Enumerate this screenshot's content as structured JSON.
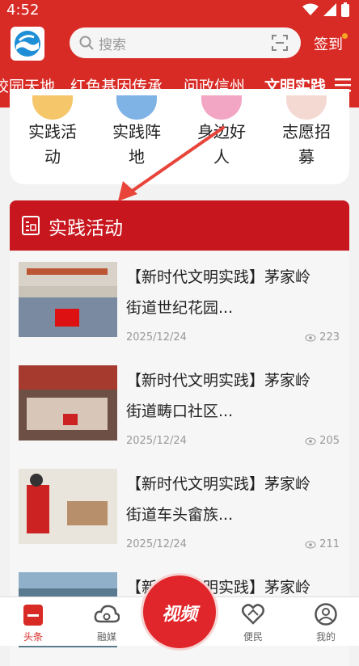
{
  "status": {
    "time": "4:52"
  },
  "header": {
    "search_placeholder": "搜索",
    "signin_label": "签到",
    "tabs": [
      {
        "label": "校园天地"
      },
      {
        "label": "红色基因传承"
      },
      {
        "label": "问政信州"
      },
      {
        "label": "文明实践"
      }
    ]
  },
  "categories": [
    {
      "line1": "实践活",
      "line2": "动"
    },
    {
      "line1": "实践阵",
      "line2": "地"
    },
    {
      "line1": "身边好",
      "line2": "人"
    },
    {
      "line1": "志愿招",
      "line2": "募"
    }
  ],
  "section": {
    "title": "实践活动"
  },
  "articles": [
    {
      "line1": "【新时代文明实践】茅家岭",
      "line2": "街道世纪花园...",
      "date": "2025/12/24",
      "views": "223"
    },
    {
      "line1": "【新时代文明实践】茅家岭",
      "line2": "街道畴口社区...",
      "date": "2025/12/24",
      "views": "205"
    },
    {
      "line1": "【新时代文明实践】茅家岭",
      "line2": "街道车头畲族...",
      "date": "2025/12/24",
      "views": "211"
    },
    {
      "line1": "【新时代文明实践】茅家岭",
      "line2": "",
      "date": "",
      "views": ""
    }
  ],
  "bottom_nav": [
    {
      "label": "头条"
    },
    {
      "label": "融媒"
    },
    {
      "label": "视频"
    },
    {
      "label": "便民"
    },
    {
      "label": "我的"
    }
  ],
  "colors": {
    "brand": "#d92b26",
    "section": "#c8161e"
  }
}
